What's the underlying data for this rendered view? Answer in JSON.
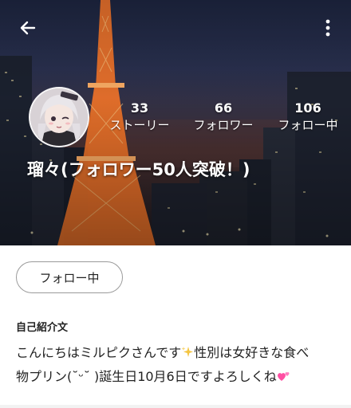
{
  "header": {
    "back_icon": "arrow-left-icon",
    "more_icon": "more-vertical-icon"
  },
  "profile": {
    "display_name": "瑠々(フォロワー50人突破！)",
    "stats": {
      "stories": {
        "count": "33",
        "label": "ストーリー"
      },
      "followers": {
        "count": "66",
        "label": "フォロワー"
      },
      "following": {
        "count": "106",
        "label": "フォロー中"
      }
    }
  },
  "actions": {
    "follow_label": "フォロー中"
  },
  "bio": {
    "heading": "自己紹介文",
    "line1": "こんにちはミルピクさんです",
    "line1b": "性別は女好きな食べ",
    "line2": "物プリン(˘ᵕ˘ )誕生日10月6日ですよろしくね",
    "sparkle_emoji": "sparkles-icon",
    "heart_emoji": "two-hearts-icon"
  },
  "colors": {
    "accent_sparkle": "#f4c542",
    "accent_heart": "#ff4fa3",
    "tower": "#ff7a2a"
  }
}
